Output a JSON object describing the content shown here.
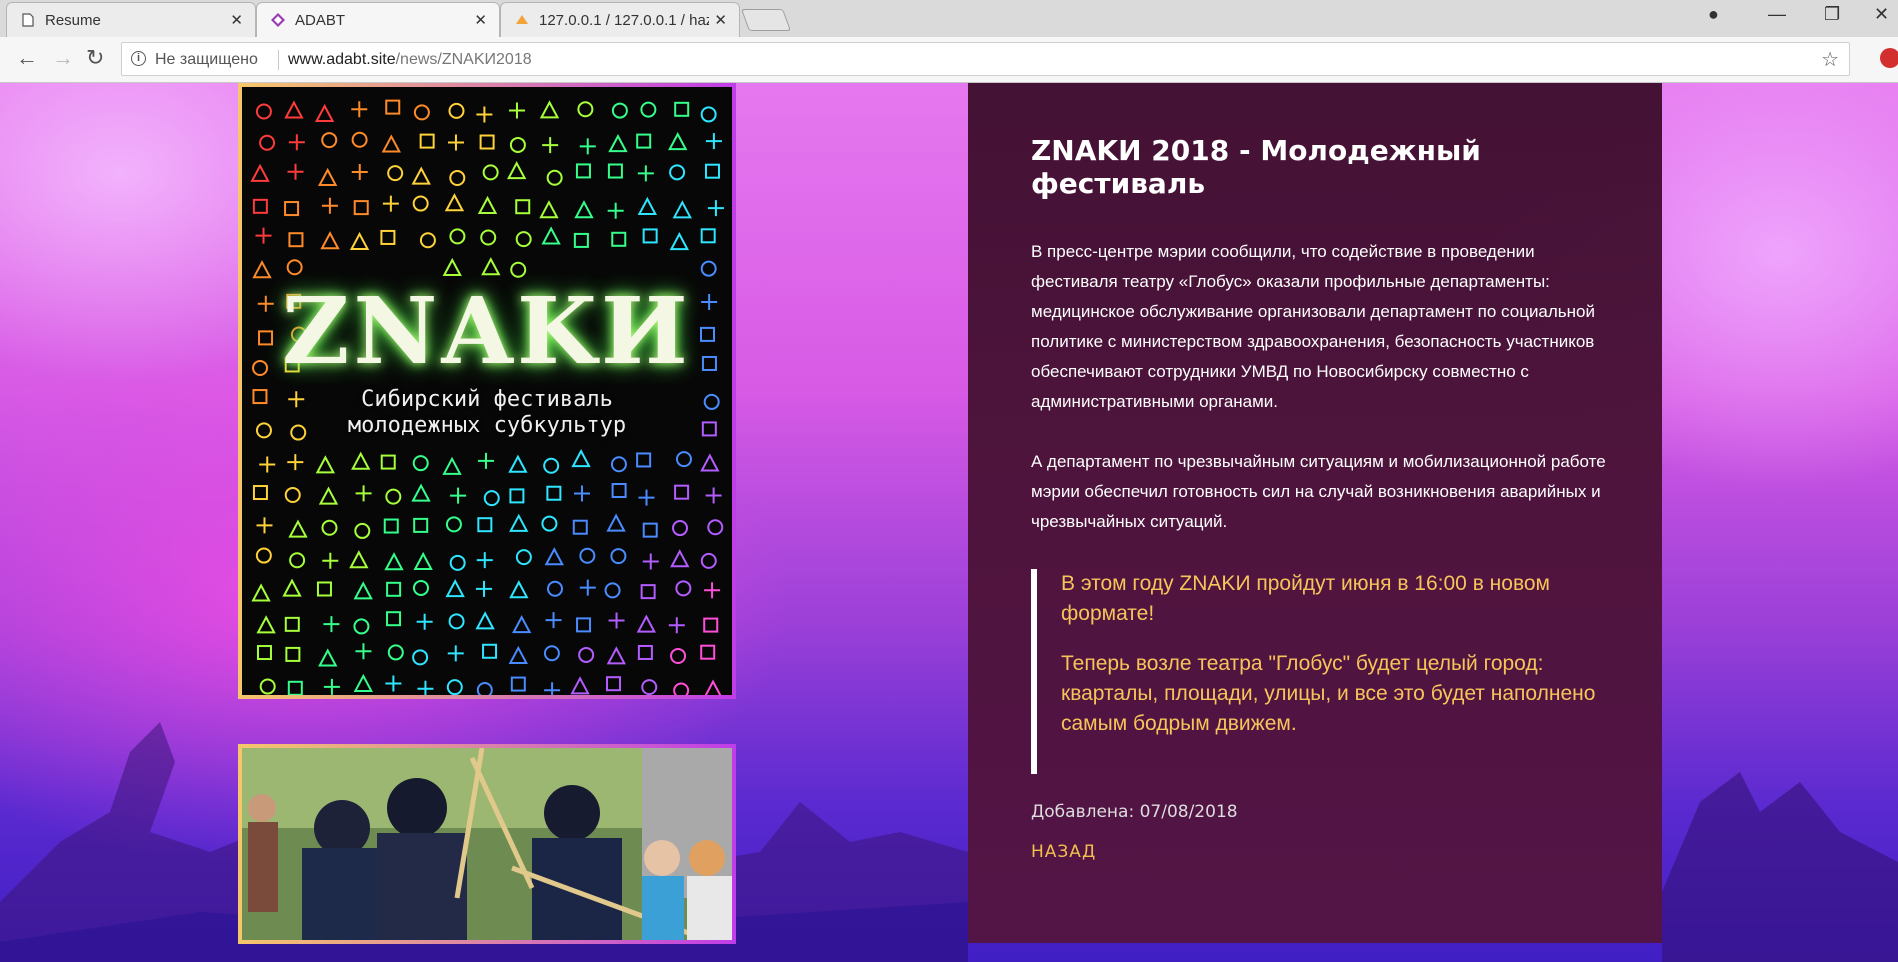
{
  "browser": {
    "tabs": [
      {
        "title": "Resume",
        "icon": "document-icon",
        "active": false
      },
      {
        "title": "ADABT",
        "icon": "site-logo-icon",
        "active": true
      },
      {
        "title": "127.0.0.1 / 127.0.0.1 / haz",
        "icon": "phpmyadmin-icon",
        "active": false
      }
    ],
    "security_label": "Не защищено",
    "url_host": "www.adabt.site",
    "url_path": "/news/ZNAKИ2018"
  },
  "poster": {
    "title": "ZNAKИ",
    "subtitle_line1": "Сибирский фестиваль",
    "subtitle_line2": "молодежных субкультур"
  },
  "article": {
    "title": "ZNAKИ 2018 - Молодежный фестиваль",
    "paragraph1": "В пресс-центре мэрии сообщили, что содействие в проведении фестиваля театру «Глобус» оказали профильные департаменты: медицинское обслуживание организовали департамент по социальной политике с министерством здравоохранения, безопасность участников обеспечивают сотрудники УМВД по Новосибирску совместно с административными органами.",
    "paragraph2": "А департамент по чрезвычайным ситуациям и мобилизационной работе мэрии обеспечил готовность сил на случай возникновения аварийных и чрезвычайных ситуаций.",
    "quote1": "В этом году ZNAKИ пройдут июня в 16:00 в новом формате!",
    "quote2": "Теперь возле театра \"Глобус\" будет целый город: кварталы, площади, улицы, и все это будет наполнено самым бодрым движем.",
    "added": "Добавлена: 07/08/2018",
    "back_label": "НАЗАД"
  },
  "colors": {
    "panel": "#3e0e2e",
    "quote_text": "#f7c45a",
    "back_link": "#f2c04c",
    "frame_gradient": [
      "#f6c66a",
      "#c03ee8"
    ]
  }
}
